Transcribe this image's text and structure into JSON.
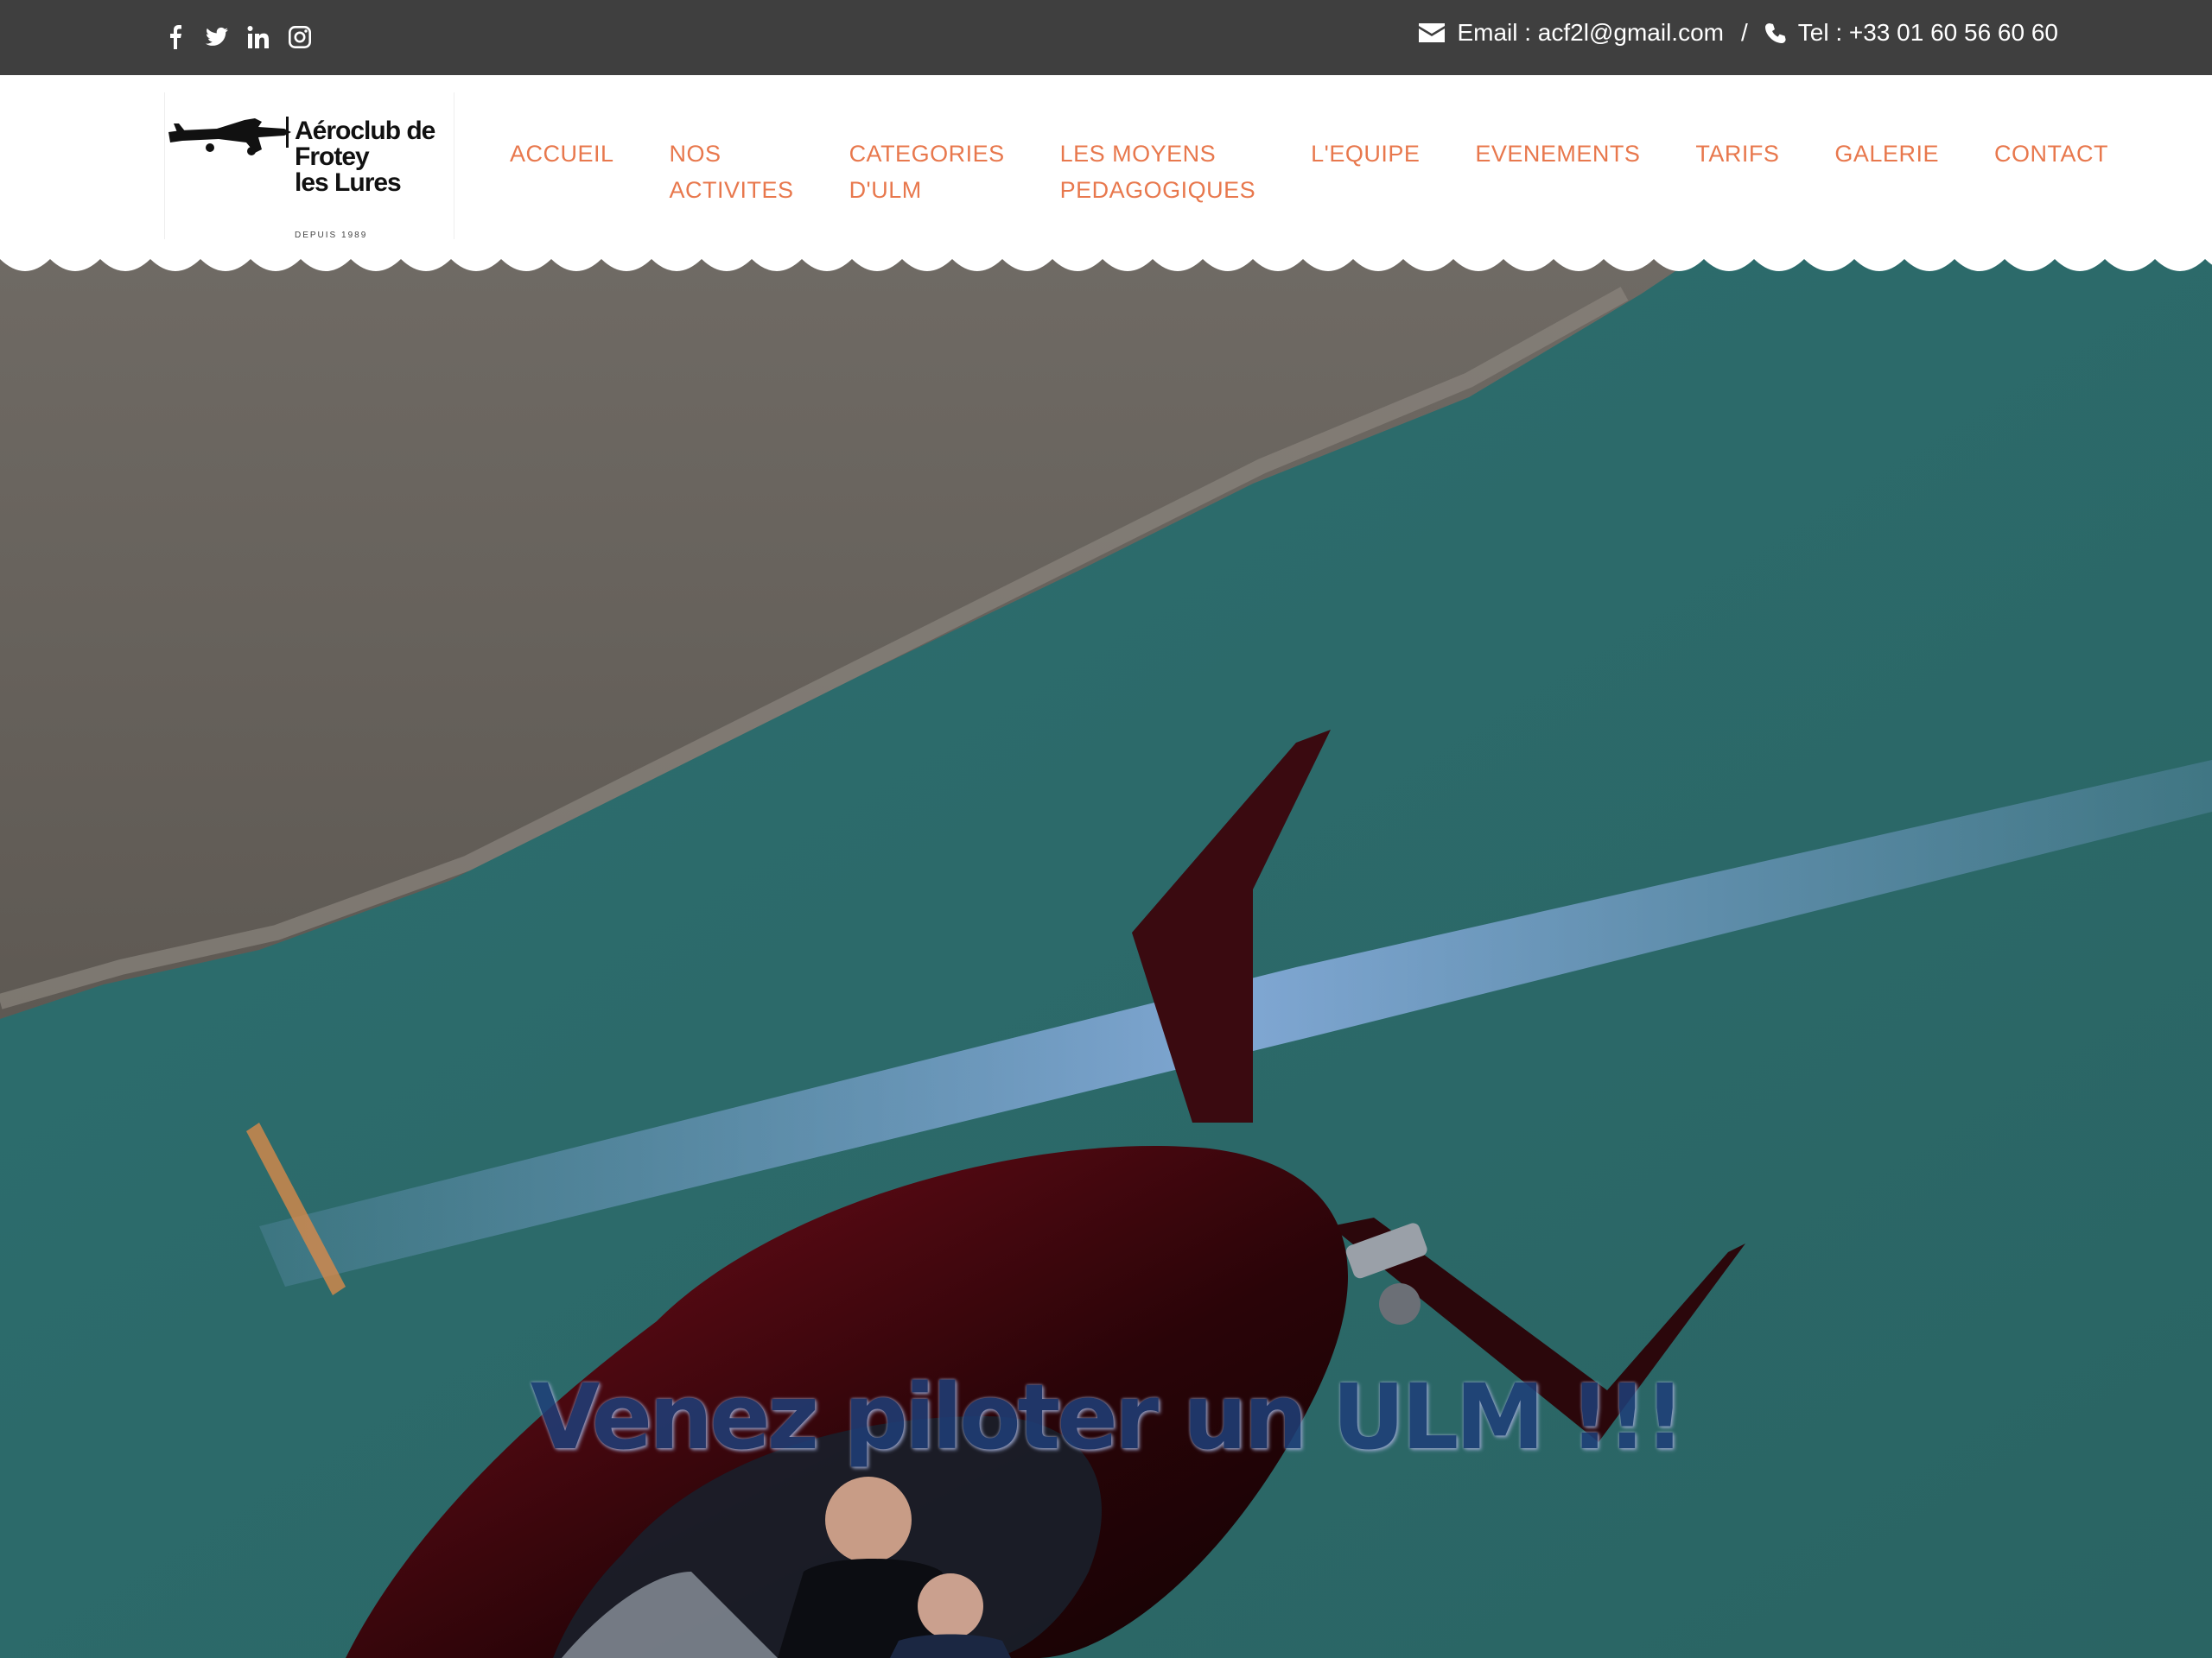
{
  "topbar": {
    "social_icons": [
      "facebook-icon",
      "twitter-icon",
      "linkedin-icon",
      "instagram-icon"
    ],
    "email_label": "Email : acf2l@gmail.com",
    "separator": "/",
    "phone_label": "Tel : +33 01 60 56 60 60"
  },
  "logo": {
    "name": "Aéroclub de\nFrotey\nles Lures",
    "since": "DEPUIS 1989"
  },
  "nav": {
    "items": [
      {
        "label": "ACCUEIL"
      },
      {
        "label": "NOS\nACTIVITES"
      },
      {
        "label": "CATEGORIES\nD'ULM"
      },
      {
        "label": "LES MOYENS\nPEDAGOGIQUES"
      },
      {
        "label": "L'EQUIPE"
      },
      {
        "label": "EVENEMENTS"
      },
      {
        "label": "TARIFS"
      },
      {
        "label": "GALERIE"
      },
      {
        "label": "CONTACT"
      }
    ]
  },
  "hero": {
    "title": "Venez piloter un ULM !!!",
    "image": "gyrocopter-over-sea-photo"
  },
  "colors": {
    "topbar_bg": "#3f3f3f",
    "nav_accent": "#e8784d",
    "hero_title": "#1f3f79",
    "sea": "#2f6f6e",
    "rock": "#6d6660"
  }
}
